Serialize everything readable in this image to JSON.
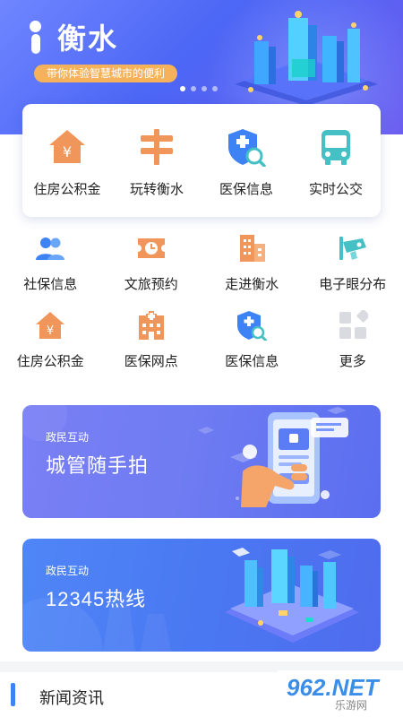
{
  "header": {
    "app_title": "衡水",
    "slogan": "带你体验智慧城市的便利",
    "carousel": {
      "pages": 4,
      "active": 0
    }
  },
  "featured_services": [
    {
      "label": "住房公积金",
      "icon": "house-yen-icon"
    },
    {
      "label": "玩转衡水",
      "icon": "signpost-icon"
    },
    {
      "label": "医保信息",
      "icon": "medical-shield-search-icon"
    },
    {
      "label": "实时公交",
      "icon": "bus-icon"
    }
  ],
  "services_row1": [
    {
      "label": "社保信息",
      "icon": "people-icon"
    },
    {
      "label": "文旅预约",
      "icon": "ticket-clock-icon"
    },
    {
      "label": "走进衡水",
      "icon": "buildings-icon"
    },
    {
      "label": "电子眼分布",
      "icon": "camera-icon"
    }
  ],
  "services_row2": [
    {
      "label": "住房公积金",
      "icon": "house-yen-icon"
    },
    {
      "label": "医保网点",
      "icon": "hospital-icon"
    },
    {
      "label": "医保信息",
      "icon": "medical-shield-search-icon"
    },
    {
      "label": "更多",
      "icon": "more-grid-icon"
    }
  ],
  "banners": [
    {
      "tag": "政民互动",
      "headline": "城管随手拍",
      "art": "phone-photo-illustration"
    },
    {
      "tag": "政民互动",
      "headline": "12345热线",
      "art": "smart-city-illustration"
    }
  ],
  "news": {
    "title": "新闻资讯"
  },
  "watermark": {
    "main": "962.NET",
    "sub": "乐游网"
  },
  "colors": {
    "orange": "#f0965a",
    "blue": "#3d83f6",
    "teal": "#45c1c6",
    "header": "#5a72f5"
  }
}
